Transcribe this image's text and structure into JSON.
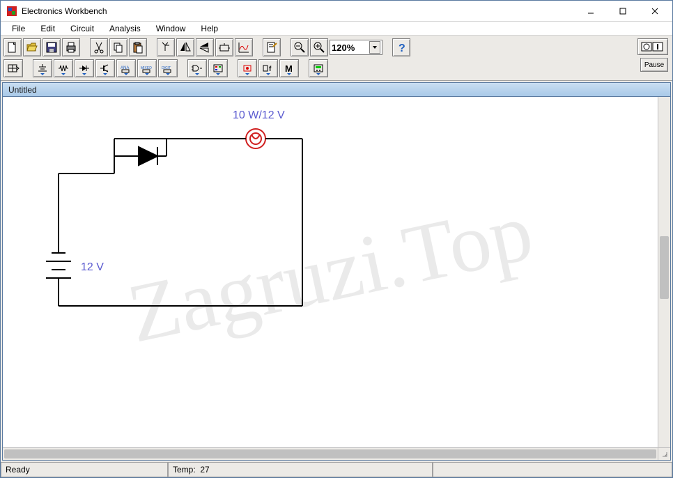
{
  "window": {
    "title": "Electronics Workbench"
  },
  "menu": {
    "file": "File",
    "edit": "Edit",
    "circuit": "Circuit",
    "analysis": "Analysis",
    "window": "Window",
    "help": "Help"
  },
  "toolbar": {
    "zoom": "120%",
    "pause": "Pause"
  },
  "document": {
    "title": "Untitled"
  },
  "circuit": {
    "lamp_label": "10 W/12 V",
    "battery_label": "12 V"
  },
  "status": {
    "ready": "Ready",
    "temp_label": "Temp:",
    "temp_value": "27"
  },
  "watermark": "Zagruzi.Top"
}
